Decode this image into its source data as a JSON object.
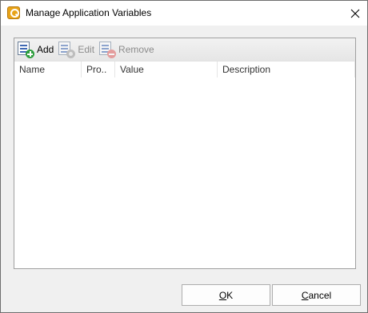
{
  "window": {
    "title": "Manage Application Variables",
    "app_icon": "pdf-app-icon",
    "close_icon": "close-icon"
  },
  "toolbar": {
    "add_label": "Add",
    "edit_label": "Edit",
    "remove_label": "Remove"
  },
  "table": {
    "columns": [
      "Name",
      "Pro..",
      "Value",
      "Description"
    ],
    "rows": []
  },
  "buttons": {
    "ok_label": "OK",
    "cancel_label": "Cancel"
  },
  "colors": {
    "add_badge": "#2e9e3e",
    "remove_badge": "#e06060",
    "window_bg": "#f0f0f0"
  }
}
